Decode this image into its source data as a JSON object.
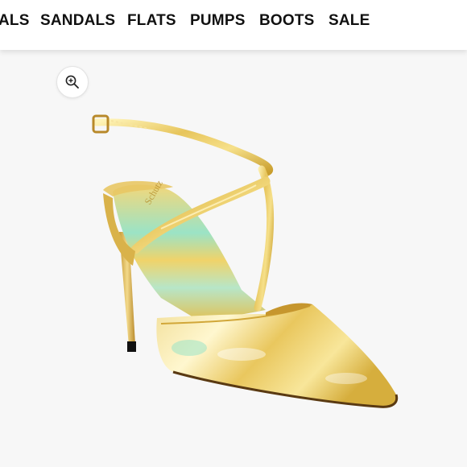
{
  "nav": {
    "items": [
      {
        "label": "ALS"
      },
      {
        "label": "SANDALS"
      },
      {
        "label": "FLATS"
      },
      {
        "label": "PUMPS"
      },
      {
        "label": "BOOTS"
      },
      {
        "label": "SALE"
      }
    ]
  },
  "product_image": {
    "icon": "zoom-in-icon",
    "subject": "gold-iridescent-pointed-toe-slingback-pump"
  },
  "colors": {
    "nav_text": "#111111",
    "stage_bg": "#f7f7f7",
    "gold": "#e3c25a",
    "iridescent": "#8fe0c7"
  }
}
